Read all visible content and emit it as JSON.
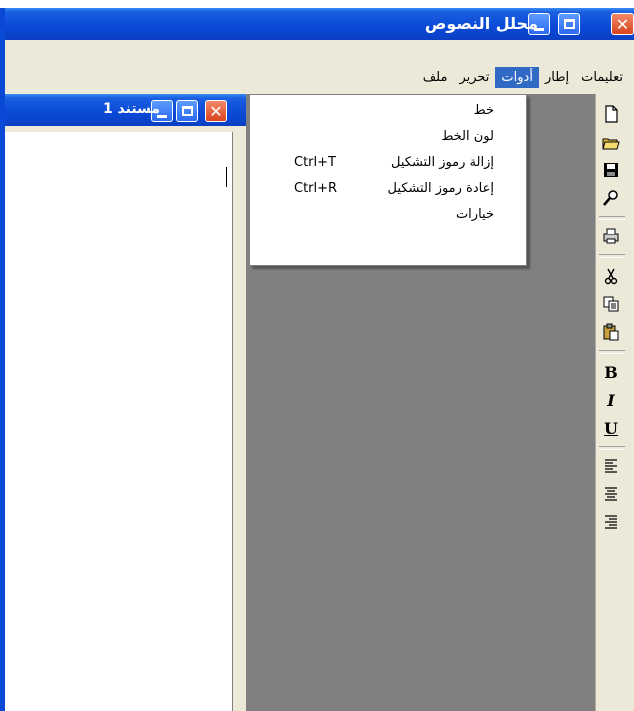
{
  "window": {
    "title": "محلل النصوص"
  },
  "menubar": {
    "items": [
      {
        "label": "ملف",
        "active": false
      },
      {
        "label": "تحرير",
        "active": false
      },
      {
        "label": "أدوات",
        "active": true
      },
      {
        "label": "إطار",
        "active": false
      },
      {
        "label": "تعليمات",
        "active": false
      }
    ]
  },
  "document": {
    "title": "مستند 1"
  },
  "dropdown": {
    "items": [
      {
        "label": "خط",
        "shortcut": ""
      },
      {
        "label": "لون الخط",
        "shortcut": ""
      },
      {
        "label": "إزالة رموز التشكيل",
        "shortcut": "Ctrl+T"
      },
      {
        "label": "إعادة رموز التشكيل",
        "shortcut": "Ctrl+R"
      },
      {
        "label": "خيارات",
        "shortcut": ""
      }
    ]
  },
  "toolbar": {
    "bold_label": "B",
    "italic_label": "I",
    "underline_label": "U",
    "icons": [
      "new-file-icon",
      "open-folder-icon",
      "save-icon",
      "find-icon",
      "print-icon",
      "cut-icon",
      "copy-icon",
      "paste-icon",
      "bold-icon",
      "italic-icon",
      "underline-icon",
      "align-right-icon",
      "align-center-icon",
      "align-left-icon"
    ]
  },
  "colors": {
    "titlebar": "#0a49d6",
    "menu_highlight": "#316ac5",
    "workspace": "#808080",
    "chrome": "#ece9d8"
  }
}
